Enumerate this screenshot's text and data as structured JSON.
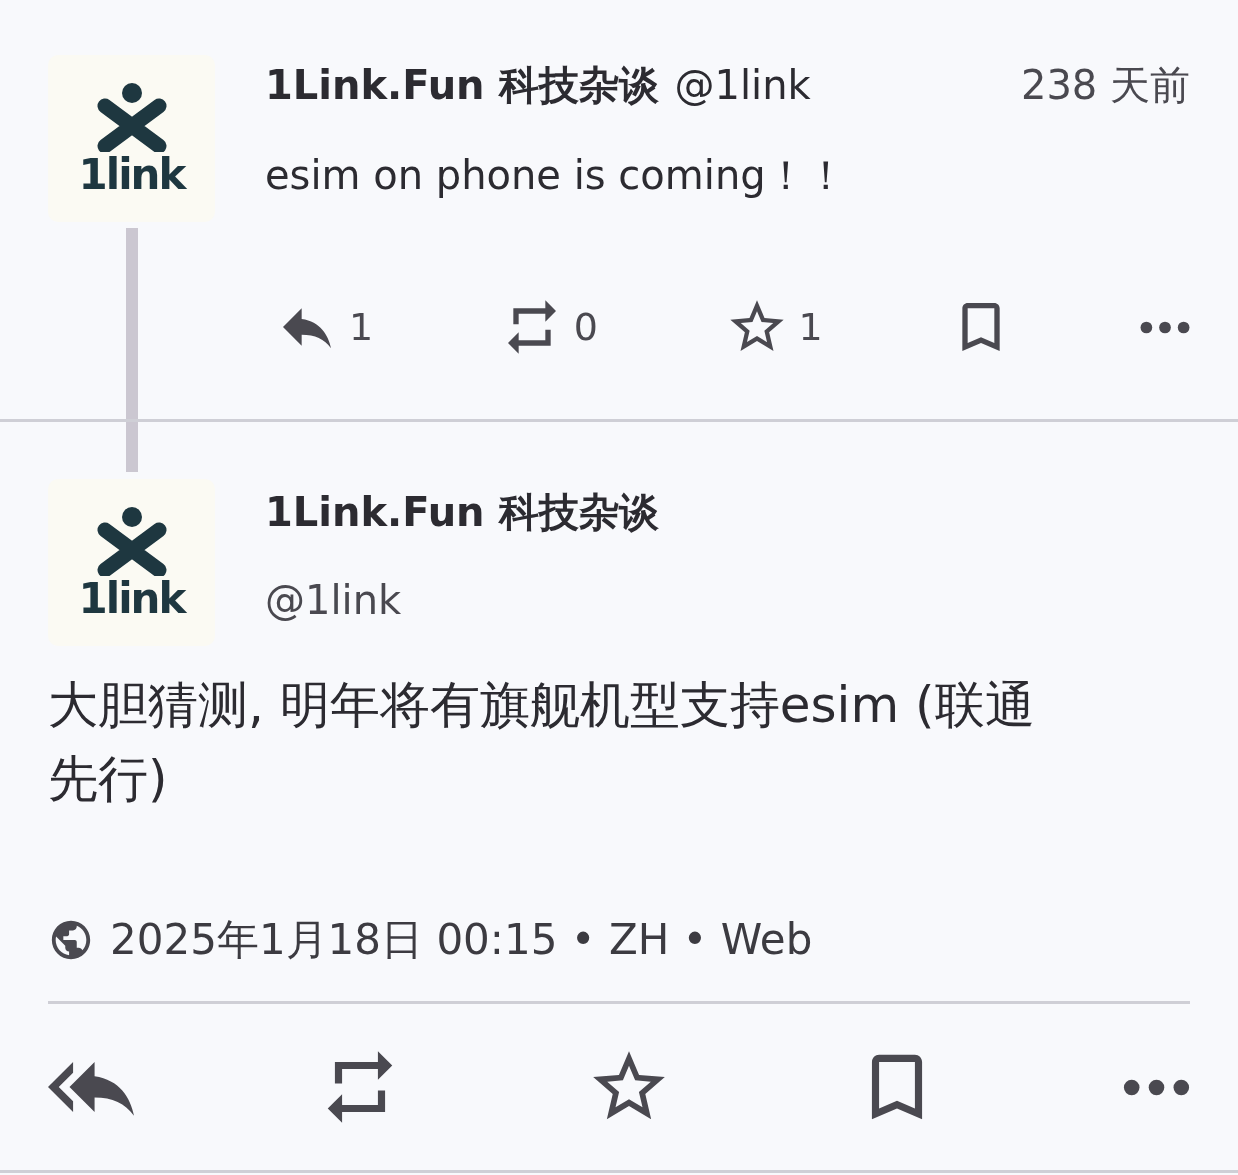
{
  "thread": [
    {
      "kind": "parent",
      "avatar": {
        "logo_text": "1link"
      },
      "display_name": "1Link.Fun 科技杂谈",
      "handle": "@1link",
      "time": "238 天前",
      "content": "esim on phone is coming！！",
      "actions": [
        {
          "kind": "reply",
          "count": "1"
        },
        {
          "kind": "boost",
          "count": "0"
        },
        {
          "kind": "favourite",
          "count": "1"
        },
        {
          "kind": "bookmark"
        },
        {
          "kind": "more"
        }
      ]
    },
    {
      "kind": "focused",
      "avatar": {
        "logo_text": "1link"
      },
      "display_name": "1Link.Fun 科技杂谈",
      "handle": "@1link",
      "content": "大胆猜测, 明年将有旗舰机型支持esim (联通先行)",
      "meta": "2025年1月18日 00:15 • ZH • Web",
      "actions": [
        {
          "kind": "reply_all"
        },
        {
          "kind": "boost"
        },
        {
          "kind": "favourite"
        },
        {
          "kind": "bookmark"
        },
        {
          "kind": "more"
        }
      ]
    }
  ]
}
